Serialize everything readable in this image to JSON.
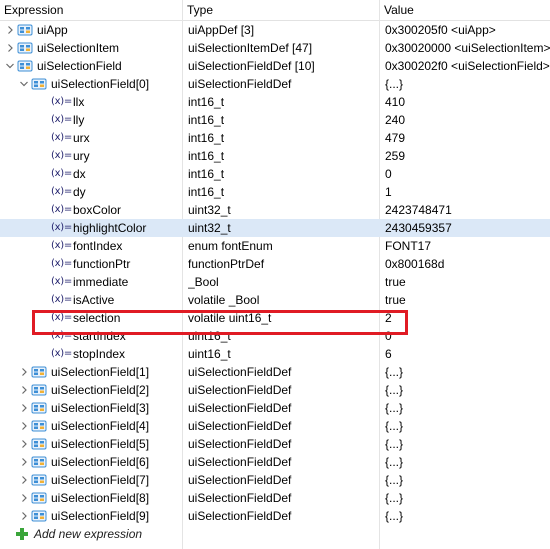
{
  "header": {
    "expression": "Expression",
    "type": "Type",
    "value": "Value"
  },
  "rows": [
    {
      "name": "uiApp",
      "type": "uiAppDef [3]",
      "value": "0x300205f0 <uiApp>",
      "level": 0,
      "expander": "collapsed",
      "icon": "struct-icon"
    },
    {
      "name": "uiSelectionItem",
      "type": "uiSelectionItemDef [47]",
      "value": "0x30020000 <uiSelectionItem>",
      "level": 0,
      "expander": "collapsed",
      "icon": "struct-icon"
    },
    {
      "name": "uiSelectionField",
      "type": "uiSelectionFieldDef [10]",
      "value": "0x300202f0 <uiSelectionField>",
      "level": 0,
      "expander": "expanded",
      "icon": "struct-icon"
    },
    {
      "name": "uiSelectionField[0]",
      "type": "uiSelectionFieldDef",
      "value": "{...}",
      "level": 1,
      "expander": "expanded",
      "icon": "struct-icon"
    },
    {
      "name": "llx",
      "type": "int16_t",
      "value": "410",
      "level": 2,
      "icon": "variable-icon"
    },
    {
      "name": "lly",
      "type": "int16_t",
      "value": "240",
      "level": 2,
      "icon": "variable-icon"
    },
    {
      "name": "urx",
      "type": "int16_t",
      "value": "479",
      "level": 2,
      "icon": "variable-icon"
    },
    {
      "name": "ury",
      "type": "int16_t",
      "value": "259",
      "level": 2,
      "icon": "variable-icon"
    },
    {
      "name": "dx",
      "type": "int16_t",
      "value": "0",
      "level": 2,
      "icon": "variable-icon"
    },
    {
      "name": "dy",
      "type": "int16_t",
      "value": "1",
      "level": 2,
      "icon": "variable-icon"
    },
    {
      "name": "boxColor",
      "type": "uint32_t",
      "value": "2423748471",
      "level": 2,
      "icon": "variable-icon"
    },
    {
      "name": "highlightColor",
      "type": "uint32_t",
      "value": "2430459357",
      "level": 2,
      "icon": "variable-icon",
      "selected": true
    },
    {
      "name": "fontIndex",
      "type": "enum fontEnum",
      "value": "FONT17",
      "level": 2,
      "icon": "variable-icon"
    },
    {
      "name": "functionPtr",
      "type": "functionPtrDef",
      "value": "0x800168d",
      "level": 2,
      "icon": "variable-icon"
    },
    {
      "name": "immediate",
      "type": "_Bool",
      "value": "true",
      "level": 2,
      "icon": "variable-icon"
    },
    {
      "name": "isActive",
      "type": "volatile _Bool",
      "value": "true",
      "level": 2,
      "icon": "variable-icon"
    },
    {
      "name": "selection",
      "type": "volatile uint16_t",
      "value": "2",
      "level": 2,
      "icon": "variable-icon",
      "annotated": true
    },
    {
      "name": "startIndex",
      "type": "uint16_t",
      "value": "0",
      "level": 2,
      "icon": "variable-icon"
    },
    {
      "name": "stopIndex",
      "type": "uint16_t",
      "value": "6",
      "level": 2,
      "icon": "variable-icon"
    },
    {
      "name": "uiSelectionField[1]",
      "type": "uiSelectionFieldDef",
      "value": "{...}",
      "level": 1,
      "expander": "collapsed",
      "icon": "struct-icon"
    },
    {
      "name": "uiSelectionField[2]",
      "type": "uiSelectionFieldDef",
      "value": "{...}",
      "level": 1,
      "expander": "collapsed",
      "icon": "struct-icon"
    },
    {
      "name": "uiSelectionField[3]",
      "type": "uiSelectionFieldDef",
      "value": "{...}",
      "level": 1,
      "expander": "collapsed",
      "icon": "struct-icon"
    },
    {
      "name": "uiSelectionField[4]",
      "type": "uiSelectionFieldDef",
      "value": "{...}",
      "level": 1,
      "expander": "collapsed",
      "icon": "struct-icon"
    },
    {
      "name": "uiSelectionField[5]",
      "type": "uiSelectionFieldDef",
      "value": "{...}",
      "level": 1,
      "expander": "collapsed",
      "icon": "struct-icon"
    },
    {
      "name": "uiSelectionField[6]",
      "type": "uiSelectionFieldDef",
      "value": "{...}",
      "level": 1,
      "expander": "collapsed",
      "icon": "struct-icon"
    },
    {
      "name": "uiSelectionField[7]",
      "type": "uiSelectionFieldDef",
      "value": "{...}",
      "level": 1,
      "expander": "collapsed",
      "icon": "struct-icon"
    },
    {
      "name": "uiSelectionField[8]",
      "type": "uiSelectionFieldDef",
      "value": "{...}",
      "level": 1,
      "expander": "collapsed",
      "icon": "struct-icon"
    },
    {
      "name": "uiSelectionField[9]",
      "type": "uiSelectionFieldDef",
      "value": "{...}",
      "level": 1,
      "expander": "collapsed",
      "icon": "struct-icon"
    }
  ],
  "add_expression": {
    "label": "Add new expression",
    "icon": "plus-icon"
  },
  "variable_icon_text": "(x)=",
  "colors": {
    "selected_row": "#dbe8f7",
    "annotation_box": "#e01b24",
    "struct_icon": "#3d8fd6",
    "plus_icon": "#3aa53a"
  }
}
